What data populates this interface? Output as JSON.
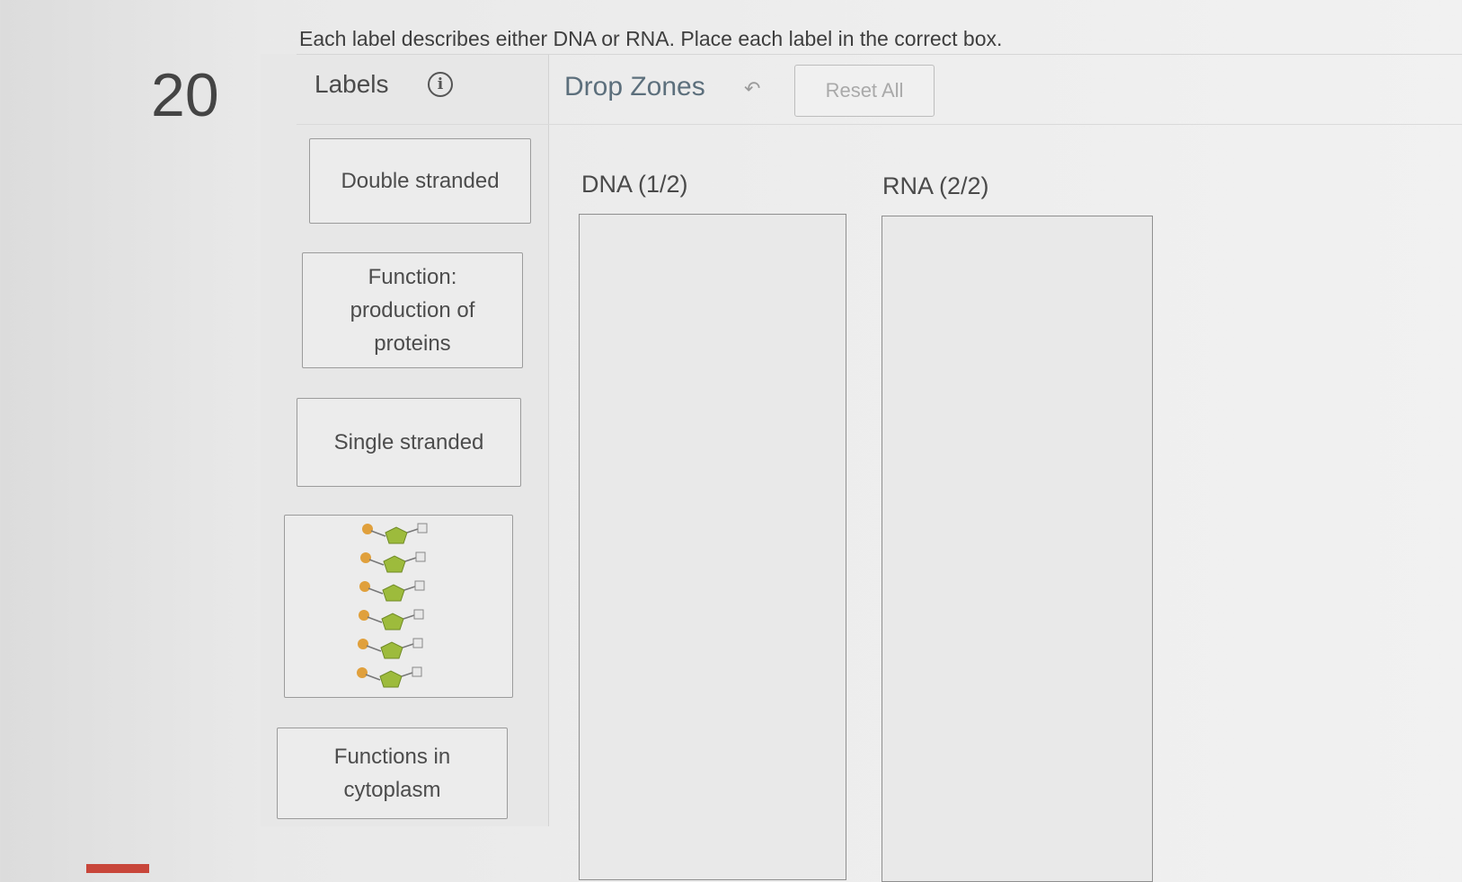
{
  "question": {
    "number": "20",
    "instruction": "Each label describes either DNA or RNA. Place each label in the correct box."
  },
  "labels_panel": {
    "title": "Labels",
    "info_icon": "info-icon",
    "items": [
      {
        "text": "Double stranded"
      },
      {
        "text": "Function: production of proteins"
      },
      {
        "text": "Single stranded"
      },
      {
        "text": "",
        "image": "nucleotide-strand-image"
      },
      {
        "text": "Functions in cytoplasm"
      }
    ]
  },
  "drop_zones": {
    "title": "Drop Zones",
    "undo_icon": "undo-arrow-icon",
    "reset_label": "Reset All",
    "zones": [
      {
        "title": "DNA (1/2)"
      },
      {
        "title": "RNA (2/2)"
      }
    ]
  },
  "colors": {
    "drop_zones_title": "#5c6f7c",
    "nucleotide_phosphate": "#e0a03c",
    "nucleotide_sugar": "#9dbb3c"
  }
}
